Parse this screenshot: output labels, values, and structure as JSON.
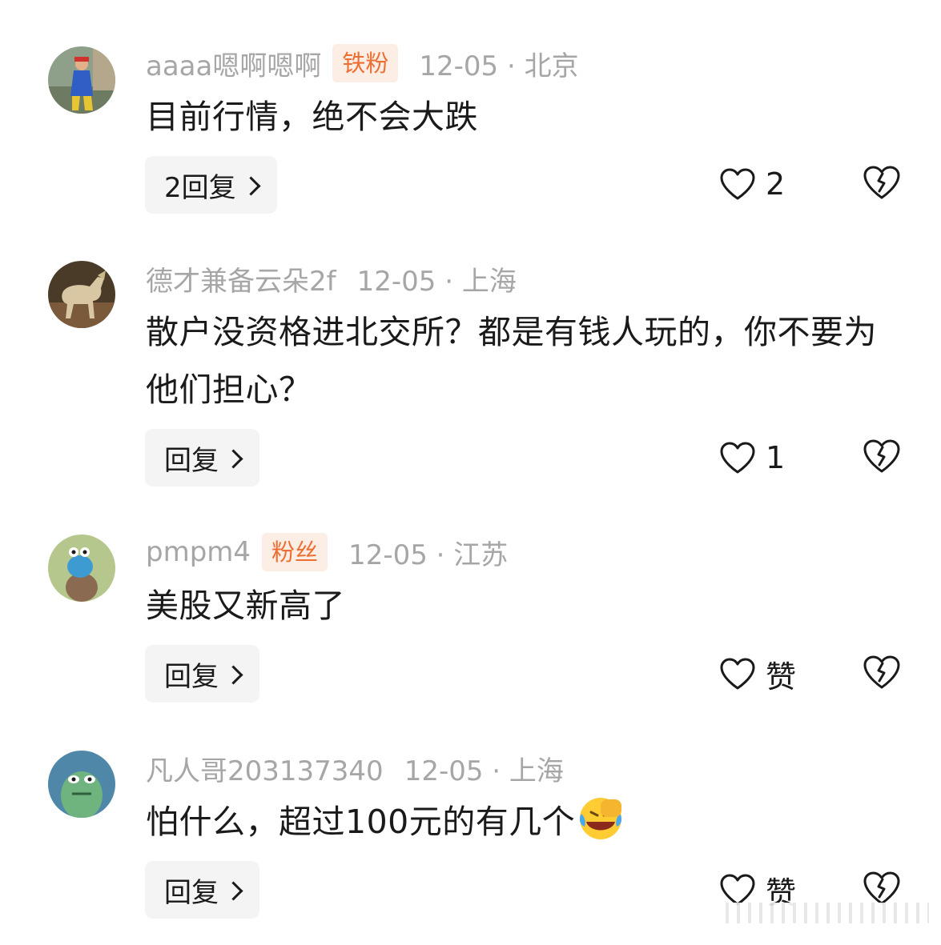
{
  "comments": [
    {
      "username": "aaaa嗯啊嗯啊",
      "badge": "铁粉",
      "time_location": "12-05 · 北京",
      "text": "目前行情，绝不会大跌",
      "reply_label": "2回复",
      "like_label": "2"
    },
    {
      "username": "德才兼备云朵2f",
      "badge": "",
      "time_location": "12-05 · 上海",
      "text": "散户没资格进北交所？都是有钱人玩的，你不要为他们担心？",
      "reply_label": "回复",
      "like_label": "1"
    },
    {
      "username": "pmpm4",
      "badge": "粉丝",
      "time_location": "12-05 · 江苏",
      "text": "美股又新高了",
      "reply_label": "回复",
      "like_label": "赞"
    },
    {
      "username": "凡人哥203137340",
      "badge": "",
      "time_location": "12-05 · 上海",
      "text": "怕什么，超过100元的有几个",
      "reply_label": "回复",
      "like_label": "赞"
    }
  ],
  "colors": {
    "meta_gray": "#a6a6a6",
    "badge_bg": "#fdeee5",
    "badge_text": "#ec6f34",
    "reply_bg": "#f4f4f4"
  },
  "icons": {
    "like": "heart-outline-icon",
    "dislike": "broken-heart-icon",
    "reply": "chevron-right-icon",
    "emoji": "laughing-tears-emoji-icon"
  }
}
